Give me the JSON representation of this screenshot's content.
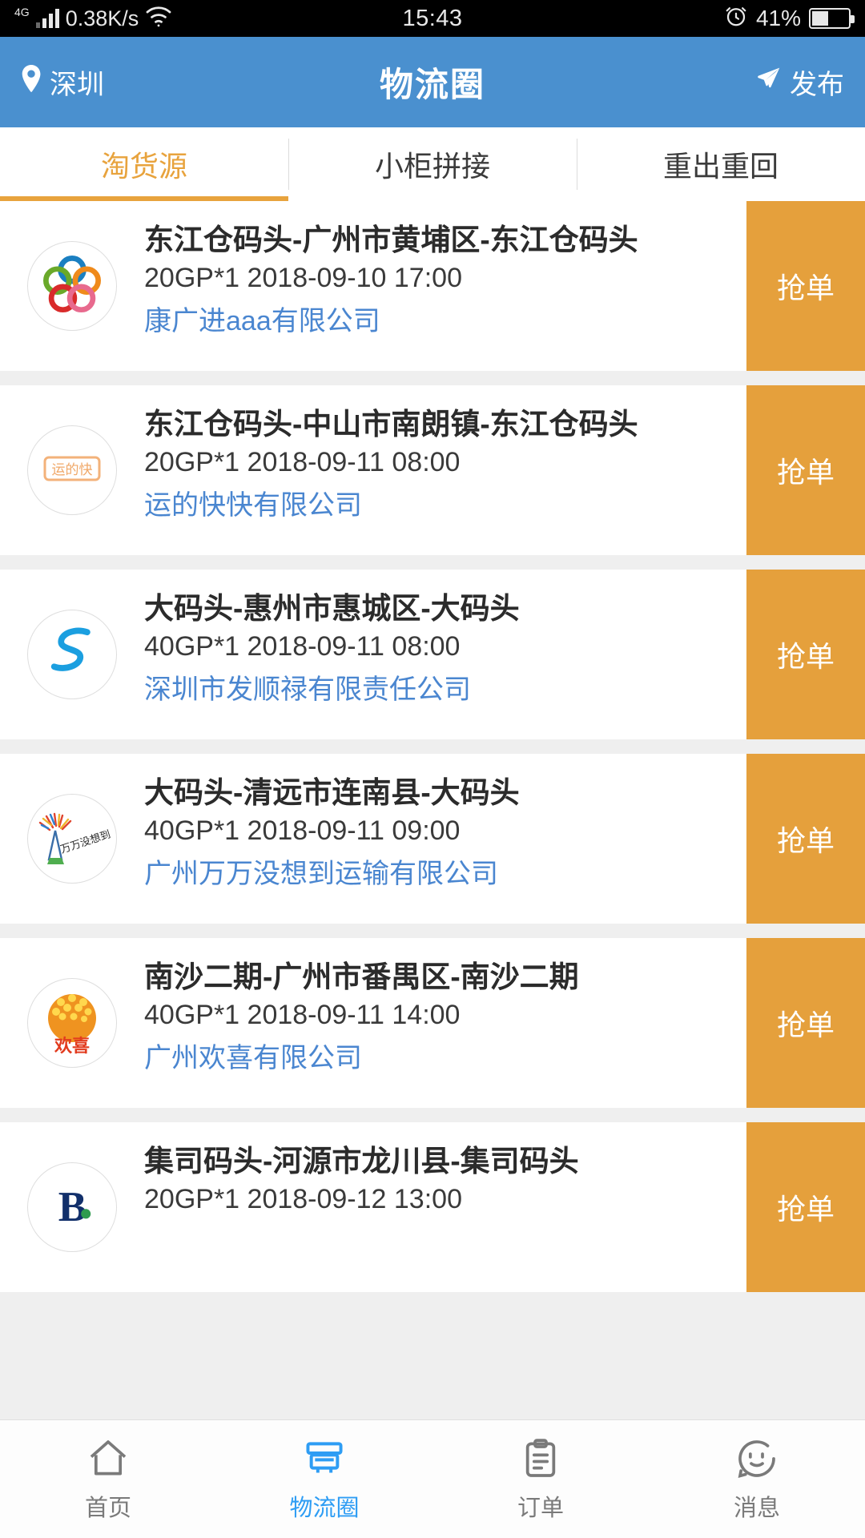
{
  "statusbar": {
    "network_type": "4G",
    "speed": "0.38K/s",
    "wifi_icon": "wifi-icon",
    "time": "15:43",
    "alarm_icon": "alarm-icon",
    "battery_percent": "41%",
    "battery_level": 41
  },
  "header": {
    "location_icon": "location-pin-icon",
    "location": "深圳",
    "title": "物流圈",
    "publish_icon": "airplane-icon",
    "publish_label": "发布",
    "background_color": "#4a90cf"
  },
  "tabs": {
    "active_index": 0,
    "items": [
      {
        "label": "淘货源"
      },
      {
        "label": "小柜拼接"
      },
      {
        "label": "重出重回"
      }
    ],
    "active_color": "#e8a33d"
  },
  "list": {
    "grab_label": "抢单",
    "grab_color": "#e5a03c",
    "company_color": "#4a86d0",
    "items": [
      {
        "avatar_icon": "kangguangjin-logo-icon",
        "title": "东江仓码头-广州市黄埔区-东江仓码头",
        "spec": "20GP*1  2018-09-10 17:00",
        "company": "康广进aaa有限公司",
        "grab_label": "抢单"
      },
      {
        "avatar_icon": "yundikuaikuai-logo-icon",
        "title": "东江仓码头-中山市南朗镇-东江仓码头",
        "spec": "20GP*1  2018-09-11 08:00",
        "company": "运的快快有限公司",
        "grab_label": "抢单"
      },
      {
        "avatar_icon": "fashunlu-logo-icon",
        "title": "大码头-惠州市惠城区-大码头",
        "spec": "40GP*1  2018-09-11 08:00",
        "company": "深圳市发顺禄有限责任公司",
        "grab_label": "抢单"
      },
      {
        "avatar_icon": "wanwanmeixiangdao-logo-icon",
        "title": "大码头-清远市连南县-大码头",
        "spec": "40GP*1  2018-09-11 09:00",
        "company": "广州万万没想到运输有限公司",
        "grab_label": "抢单"
      },
      {
        "avatar_icon": "huanxi-logo-icon",
        "title": "南沙二期-广州市番禺区-南沙二期",
        "spec": "40GP*1  2018-09-11 14:00",
        "company": "广州欢喜有限公司",
        "grab_label": "抢单"
      },
      {
        "avatar_icon": "b-letter-logo-icon",
        "title": "集司码头-河源市龙川县-集司码头",
        "spec": "20GP*1  2018-09-12 13:00",
        "company": "",
        "grab_label": "抢单"
      }
    ]
  },
  "bottomnav": {
    "active_index": 1,
    "active_color": "#2e9df4",
    "items": [
      {
        "label": "首页",
        "icon": "home-icon"
      },
      {
        "label": "物流圈",
        "icon": "truck-icon"
      },
      {
        "label": "订单",
        "icon": "clipboard-icon"
      },
      {
        "label": "消息",
        "icon": "smiley-message-icon"
      }
    ]
  }
}
